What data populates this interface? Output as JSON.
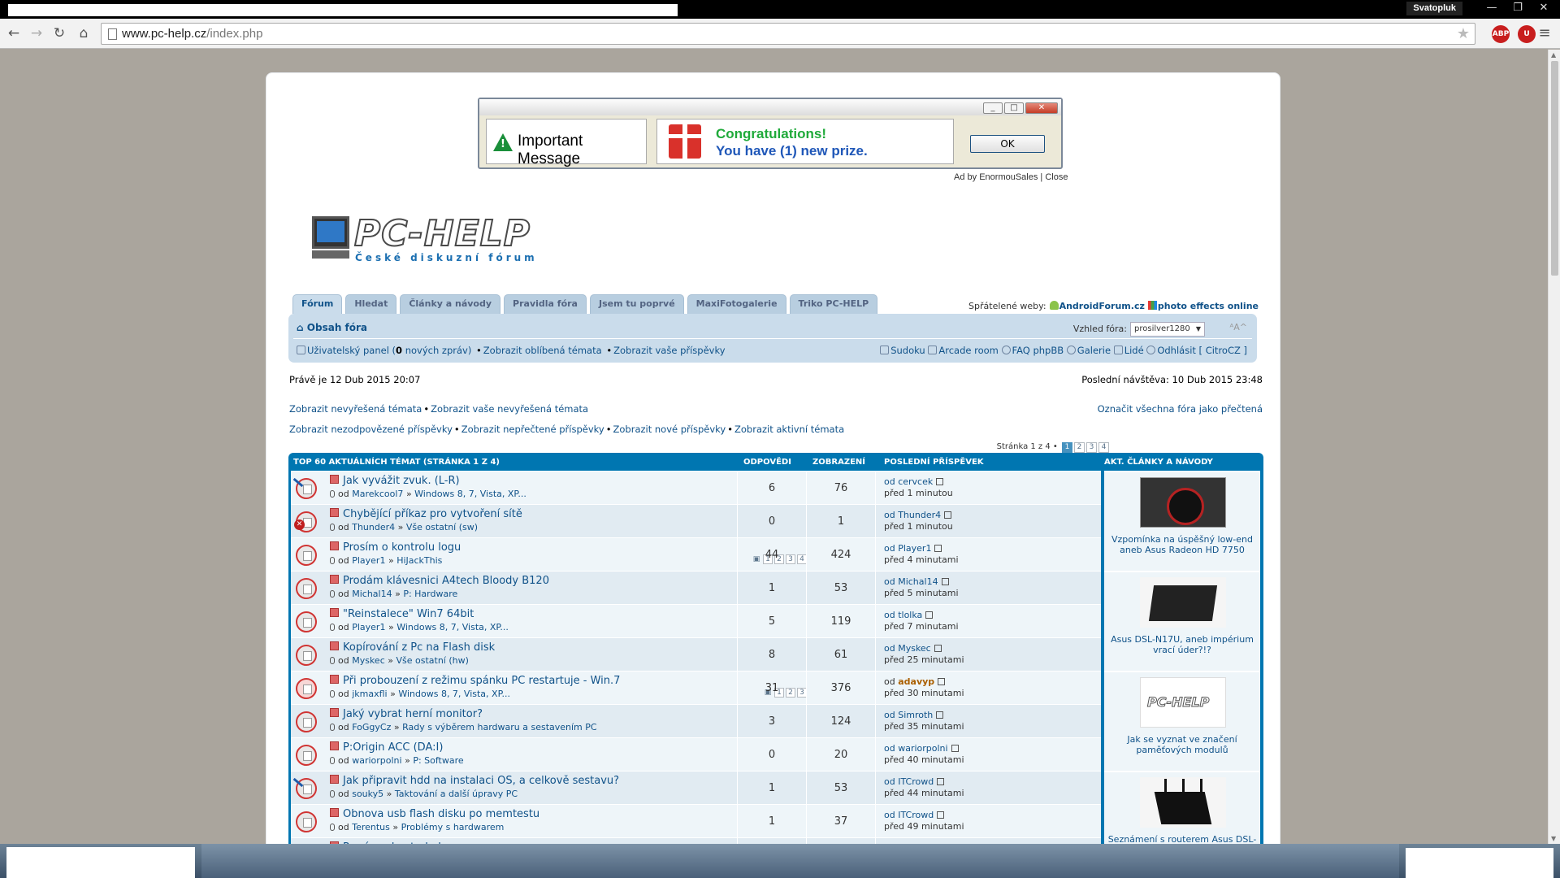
{
  "browser": {
    "user": "Svatopluk",
    "url_host": "www.pc-help.cz",
    "url_path": "/index.php",
    "ext1_label": "ABP",
    "ext2_label": "U"
  },
  "ad": {
    "title": "Important Message",
    "congrats": "Congratulations!",
    "prize": "You have (1) new prize.",
    "ok": "OK",
    "credit_prefix": "Ad by",
    "credit_name": "EnormouSales",
    "credit_sep": "|",
    "credit_close": "Close"
  },
  "logo": {
    "brand": "PC-HELP",
    "tagline": "České diskuzní fórum"
  },
  "tabs": [
    "Fórum",
    "Hledat",
    "Články a návody",
    "Pravidla fóra",
    "Jsem tu poprvé",
    "MaxiFotogalerie",
    "Triko PC-HELP"
  ],
  "friends": {
    "label": "Spřátelené weby:",
    "site1": "AndroidForum.cz",
    "site2": "photo effects online"
  },
  "navbar": {
    "home": "Obsah fóra",
    "style_label": "Vzhled fóra:",
    "style_value": "prosilver1280",
    "fontsize": "ᴬA^",
    "ucp": "Uživatelský panel",
    "ucp_count_pre": "(",
    "ucp_count": "0",
    "ucp_count_post": " nových zpráv)",
    "fav_topics": "Zobrazit oblíbená témata",
    "your_posts": "Zobrazit vaše příspěvky",
    "sudoku": "Sudoku",
    "arcade": "Arcade room",
    "faq": "FAQ phpBB",
    "gallery": "Galerie",
    "people": "Lidé",
    "logout": "Odhlásit [ CitroCZ ]"
  },
  "date_now": "Právě je 12 Dub 2015 20:07",
  "last_visit": "Poslední návštěva: 10 Dub 2015 23:48",
  "links": {
    "unanswered": "Zobrazit nevyřešená témata",
    "your_unanswered": "Zobrazit vaše nevyřešená témata",
    "mark_all": "Označit všechna fóra jako přečtená",
    "unreplied": "Zobrazit nezodpovězené příspěvky",
    "unread": "Zobrazit nepřečtené příspěvky",
    "new": "Zobrazit nové příspěvky",
    "active": "Zobrazit aktivní témata"
  },
  "pagination": {
    "label": "Stránka 1 z 4 •",
    "pages": [
      "1",
      "2",
      "3",
      "4"
    ]
  },
  "topics_header": {
    "title": "TOP 60 AKTUÁLNÍCH TÉMAT  (STRÁNKA 1 Z 4)",
    "replies": "ODPOVĚDI",
    "views": "ZOBRAZENÍ",
    "last": "POSLEDNÍ PŘÍSPĚVEK"
  },
  "topics": [
    {
      "title": "Jak vyvážit zvuk. (L-R)",
      "by": "od",
      "author": "Marekcool7",
      "arrow": "»",
      "forum": "Windows 8, 7, Vista, XP...",
      "replies": "6",
      "views": "76",
      "last_by": "od cervcek",
      "last_time": "před 1 minutou"
    },
    {
      "title": "Chybějící příkaz pro vytvoření sítě",
      "by": "od",
      "author": "Thunder4",
      "arrow": "»",
      "forum": "Vše ostatní (sw)",
      "replies": "0",
      "views": "1",
      "last_by": "od Thunder4",
      "last_time": "před 1 minutou"
    },
    {
      "title": "Prosím o kontrolu logu",
      "by": "od",
      "author": "Player1",
      "arrow": "»",
      "forum": "HiJackThis",
      "replies": "44",
      "views": "424",
      "last_by": "od Player1",
      "last_time": "před 4 minutami",
      "pages": [
        "1",
        "2",
        "3",
        "4"
      ]
    },
    {
      "title": "Prodám klávesnici A4tech Bloody B120",
      "by": "od",
      "author": "Michal14",
      "arrow": "»",
      "forum": "P: Hardware",
      "replies": "1",
      "views": "53",
      "last_by": "od Michal14",
      "last_time": "před 5 minutami"
    },
    {
      "title": "\"Reinstalece\" Win7 64bit",
      "by": "od",
      "author": "Player1",
      "arrow": "»",
      "forum": "Windows 8, 7, Vista, XP...",
      "replies": "5",
      "views": "119",
      "last_by": "od tlolka",
      "last_time": "před 7 minutami"
    },
    {
      "title": "Kopírování z Pc na Flash disk",
      "by": "od",
      "author": "Myskec",
      "arrow": "»",
      "forum": "Vše ostatní (hw)",
      "replies": "8",
      "views": "61",
      "last_by": "od Myskec",
      "last_time": "před 25 minutami"
    },
    {
      "title": "Při probouzení z režimu spánku PC restartuje - Win.7",
      "by": "od",
      "author": "jkmaxfli",
      "arrow": "»",
      "forum": "Windows 8, 7, Vista, XP...",
      "replies": "31",
      "views": "376",
      "last_by_prefix": "od",
      "last_by_name": "adavyp",
      "last_time": "před 30 minutami",
      "pages": [
        "1",
        "2",
        "3"
      ]
    },
    {
      "title": "Jaký vybrat herní monitor?",
      "by": "od",
      "author": "FoGgyCz",
      "arrow": "»",
      "forum": "Rady s výběrem hardwaru a sestavením PC",
      "replies": "3",
      "views": "124",
      "last_by": "od Simroth",
      "last_time": "před 35 minutami"
    },
    {
      "title": "P:Origin ACC (DA:I)",
      "by": "od",
      "author": "wariorpolni",
      "arrow": "»",
      "forum": "P: Software",
      "replies": "0",
      "views": "20",
      "last_by": "od wariorpolni",
      "last_time": "před 40 minutami"
    },
    {
      "title": "Jak připravit hdd na instalaci OS, a celkově sestavu?",
      "by": "od",
      "author": "souky5",
      "arrow": "»",
      "forum": "Taktování a další úpravy PC",
      "replies": "1",
      "views": "53",
      "last_by": "od ITCrowd",
      "last_time": "před 44 minutami"
    },
    {
      "title": "Obnova usb flash disku po memtestu",
      "by": "od",
      "author": "Terentus",
      "arrow": "»",
      "forum": "Problémy s hardwarem",
      "replies": "1",
      "views": "37",
      "last_by": "od ITCrowd",
      "last_time": "před 49 minutami"
    },
    {
      "title": "Prosím o kontrolu logu",
      "by": "",
      "author": "",
      "arrow": "",
      "forum": "",
      "replies": "",
      "views": "",
      "last_by": "",
      "last_time": ""
    }
  ],
  "articles": {
    "title": "AKT. ČLÁNKY A NÁVODY",
    "items": [
      {
        "caption": "Vzpomínka na úspěšný low-end aneb Asus Radeon HD 7750"
      },
      {
        "caption": "Asus DSL-N17U, aneb impérium vrací úder?!?"
      },
      {
        "caption": "Jak se vyznat ve značení paměťových modulů"
      },
      {
        "caption": "Seznámení s routerem Asus DSL-"
      }
    ]
  }
}
